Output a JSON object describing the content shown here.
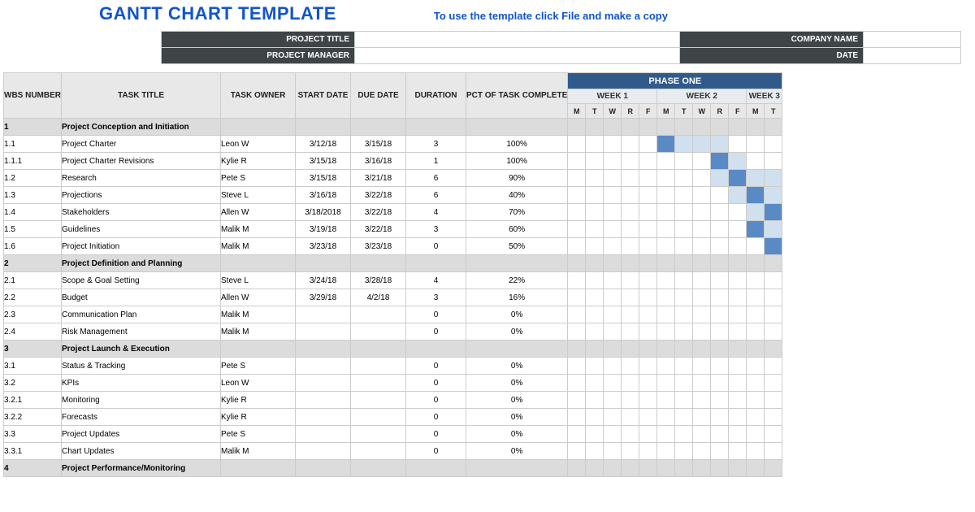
{
  "header": {
    "title": "GANTT CHART TEMPLATE",
    "instruction": "To use the template click File and make a copy"
  },
  "meta": {
    "project_title_label": "PROJECT TITLE",
    "project_title_value": "",
    "company_name_label": "COMPANY NAME",
    "company_name_value": "",
    "project_manager_label": "PROJECT MANAGER",
    "project_manager_value": "",
    "date_label": "DATE",
    "date_value": ""
  },
  "columns": {
    "wbs": "WBS NUMBER",
    "title": "TASK TITLE",
    "owner": "TASK OWNER",
    "start": "START DATE",
    "due": "DUE DATE",
    "duration": "DURATION",
    "pct": "PCT OF TASK COMPLETE"
  },
  "phase": {
    "label": "PHASE ONE",
    "weeks": [
      "WEEK 1",
      "WEEK 2",
      "WEEK 3"
    ],
    "days": [
      "M",
      "T",
      "W",
      "R",
      "F",
      "M",
      "T",
      "W",
      "R",
      "F",
      "M",
      "T"
    ]
  },
  "rows": [
    {
      "wbs": "1",
      "title": "Project Conception and Initiation",
      "owner": "",
      "start": "",
      "due": "",
      "dur": "",
      "pct": "",
      "section": true
    },
    {
      "wbs": "1.1",
      "title": "Project Charter",
      "owner": "Leon W",
      "start": "3/12/18",
      "due": "3/15/18",
      "dur": "3",
      "pct": "100%",
      "pctClass": "pct-100",
      "bars": [
        {
          "i": 5,
          "c": "bar-blue"
        },
        {
          "i": 6,
          "c": "bar-light"
        },
        {
          "i": 7,
          "c": "bar-light"
        },
        {
          "i": 8,
          "c": "bar-light"
        }
      ]
    },
    {
      "wbs": "1.1.1",
      "title": "Project Charter Revisions",
      "owner": "Kylie R",
      "start": "3/15/18",
      "due": "3/16/18",
      "dur": "1",
      "pct": "100%",
      "pctClass": "pct-100",
      "bars": [
        {
          "i": 8,
          "c": "bar-blue"
        },
        {
          "i": 9,
          "c": "bar-light"
        }
      ]
    },
    {
      "wbs": "1.2",
      "title": "Research",
      "owner": "Pete S",
      "start": "3/15/18",
      "due": "3/21/18",
      "dur": "6",
      "pct": "90%",
      "pctClass": "pct-90",
      "bars": [
        {
          "i": 8,
          "c": "bar-light"
        },
        {
          "i": 9,
          "c": "bar-blue"
        },
        {
          "i": 10,
          "c": "bar-light"
        },
        {
          "i": 11,
          "c": "bar-light"
        }
      ]
    },
    {
      "wbs": "1.3",
      "title": "Projections",
      "owner": "Steve L",
      "start": "3/16/18",
      "due": "3/22/18",
      "dur": "6",
      "pct": "40%",
      "pctClass": "pct-40",
      "bars": [
        {
          "i": 9,
          "c": "bar-light"
        },
        {
          "i": 10,
          "c": "bar-blue"
        },
        {
          "i": 11,
          "c": "bar-light"
        }
      ]
    },
    {
      "wbs": "1.4",
      "title": "Stakeholders",
      "owner": "Allen W",
      "start": "3/18/2018",
      "due": "3/22/18",
      "dur": "4",
      "pct": "70%",
      "pctClass": "pct-70",
      "bars": [
        {
          "i": 10,
          "c": "bar-light"
        },
        {
          "i": 11,
          "c": "bar-blue"
        }
      ]
    },
    {
      "wbs": "1.5",
      "title": "Guidelines",
      "owner": "Malik M",
      "start": "3/19/18",
      "due": "3/22/18",
      "dur": "3",
      "pct": "60%",
      "pctClass": "pct-60",
      "bars": [
        {
          "i": 10,
          "c": "bar-blue"
        },
        {
          "i": 11,
          "c": "bar-light"
        }
      ]
    },
    {
      "wbs": "1.6",
      "title": "Project Initiation",
      "owner": "Malik M",
      "start": "3/23/18",
      "due": "3/23/18",
      "dur": "0",
      "pct": "50%",
      "pctClass": "pct-50",
      "bars": [
        {
          "i": 11,
          "c": "bar-blue"
        }
      ]
    },
    {
      "wbs": "2",
      "title": "Project Definition and Planning",
      "owner": "",
      "start": "",
      "due": "",
      "dur": "",
      "pct": "",
      "section": true
    },
    {
      "wbs": "2.1",
      "title": "Scope & Goal Setting",
      "owner": "Steve L",
      "start": "3/24/18",
      "due": "3/28/18",
      "dur": "4",
      "pct": "22%",
      "pctClass": "pct-22"
    },
    {
      "wbs": "2.2",
      "title": "Budget",
      "owner": "Allen W",
      "start": "3/29/18",
      "due": "4/2/18",
      "dur": "3",
      "pct": "16%",
      "pctClass": "pct-16"
    },
    {
      "wbs": "2.3",
      "title": "Communication Plan",
      "owner": "Malik M",
      "start": "",
      "due": "",
      "dur": "0",
      "pct": "0%",
      "pctClass": "pct-0"
    },
    {
      "wbs": "2.4",
      "title": "Risk Management",
      "owner": "Malik M",
      "start": "",
      "due": "",
      "dur": "0",
      "pct": "0%",
      "pctClass": "pct-0"
    },
    {
      "wbs": "3",
      "title": "Project Launch & Execution",
      "owner": "",
      "start": "",
      "due": "",
      "dur": "",
      "pct": "",
      "section": true
    },
    {
      "wbs": "3.1",
      "title": "Status & Tracking",
      "owner": "Pete S",
      "start": "",
      "due": "",
      "dur": "0",
      "pct": "0%",
      "pctClass": "pct-0"
    },
    {
      "wbs": "3.2",
      "title": "KPIs",
      "owner": "Leon W",
      "start": "",
      "due": "",
      "dur": "0",
      "pct": "0%",
      "pctClass": "pct-0"
    },
    {
      "wbs": "3.2.1",
      "title": "Monitoring",
      "owner": "Kylie R",
      "start": "",
      "due": "",
      "dur": "0",
      "pct": "0%",
      "pctClass": "pct-0"
    },
    {
      "wbs": "3.2.2",
      "title": "Forecasts",
      "owner": "Kylie R",
      "start": "",
      "due": "",
      "dur": "0",
      "pct": "0%",
      "pctClass": "pct-0"
    },
    {
      "wbs": "3.3",
      "title": "Project Updates",
      "owner": "Pete S",
      "start": "",
      "due": "",
      "dur": "0",
      "pct": "0%",
      "pctClass": "pct-0"
    },
    {
      "wbs": "3.3.1",
      "title": "Chart Updates",
      "owner": "Malik M",
      "start": "",
      "due": "",
      "dur": "0",
      "pct": "0%",
      "pctClass": "pct-0"
    },
    {
      "wbs": "4",
      "title": "Project Performance/Monitoring",
      "owner": "",
      "start": "",
      "due": "",
      "dur": "",
      "pct": "",
      "section": true
    }
  ]
}
